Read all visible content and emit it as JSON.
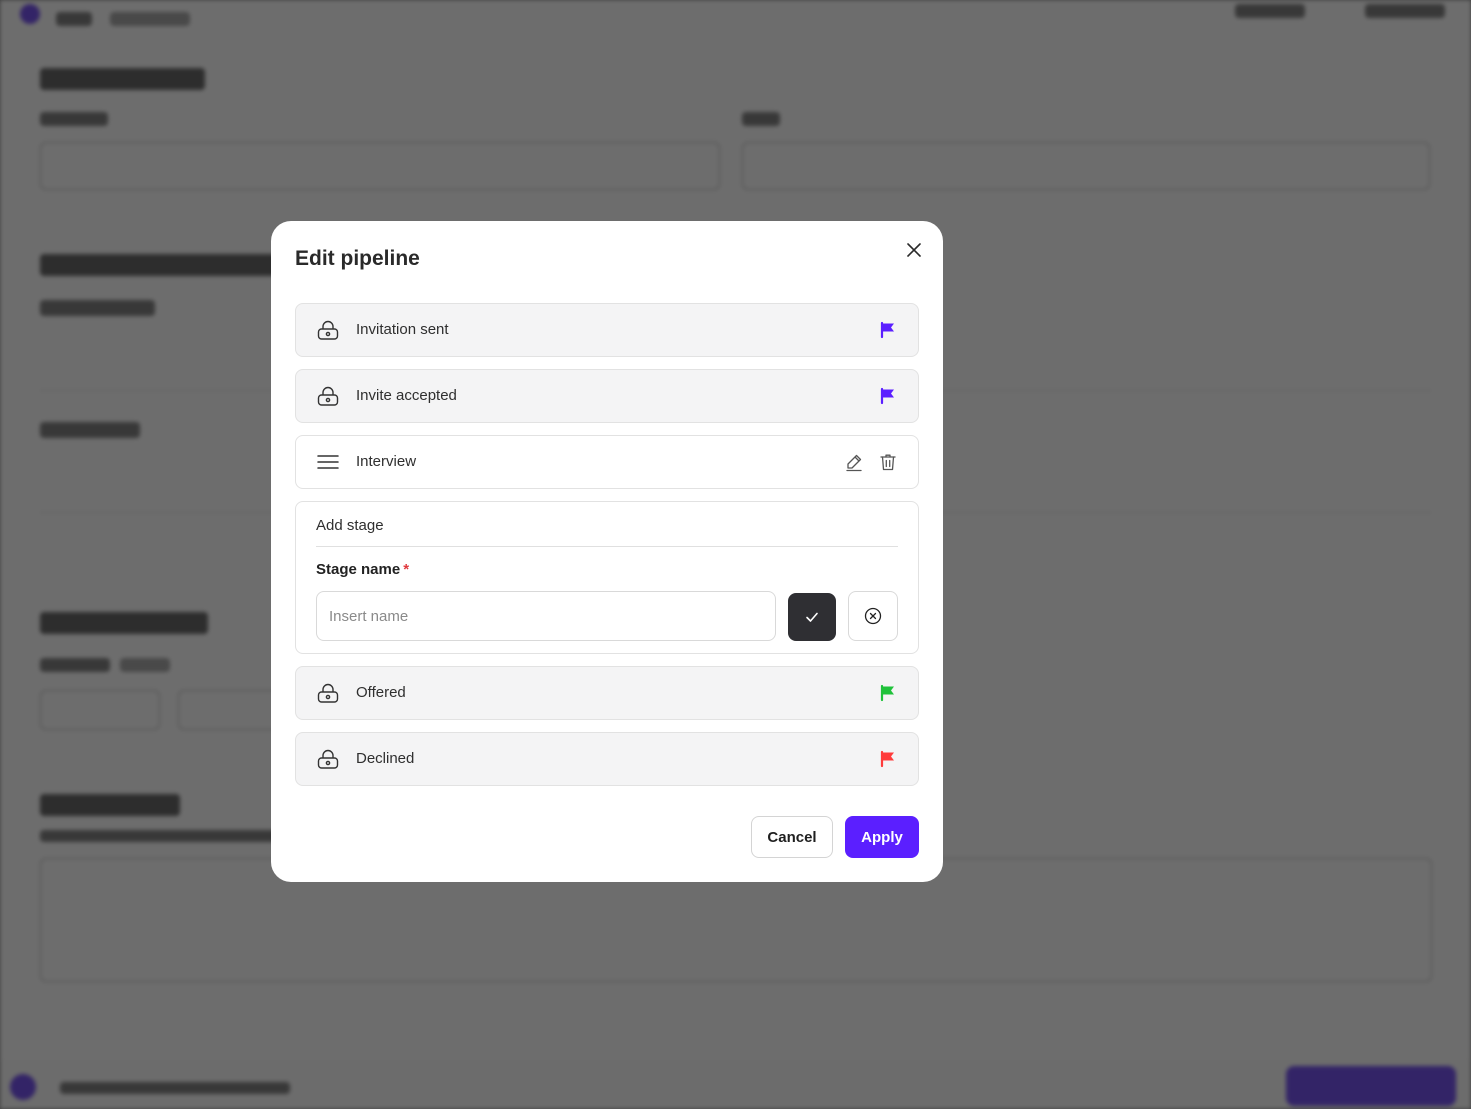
{
  "modal": {
    "title": "Edit pipeline",
    "close_icon": "close-icon"
  },
  "stages": [
    {
      "label": "Invitation sent",
      "locked": true,
      "flag_color": "#5b1fff",
      "icon": "lock-icon"
    },
    {
      "label": "Invite accepted",
      "locked": true,
      "flag_color": "#5b1fff",
      "icon": "lock-icon"
    },
    {
      "label": "Interview",
      "locked": false,
      "icon": "drag-handle-icon"
    },
    {
      "label": "Offered",
      "locked": true,
      "flag_color": "#1fc23a",
      "icon": "lock-icon"
    },
    {
      "label": "Declined",
      "locked": true,
      "flag_color": "#ff3b3b",
      "icon": "lock-icon"
    }
  ],
  "add_stage": {
    "title": "Add stage",
    "field_label": "Stage name",
    "required_mark": "*",
    "placeholder": "Insert name",
    "value": ""
  },
  "footer": {
    "cancel_label": "Cancel",
    "apply_label": "Apply"
  },
  "colors": {
    "accent": "#5b1fff",
    "confirm_button": "#2f2f33",
    "required": "#e0393e"
  }
}
